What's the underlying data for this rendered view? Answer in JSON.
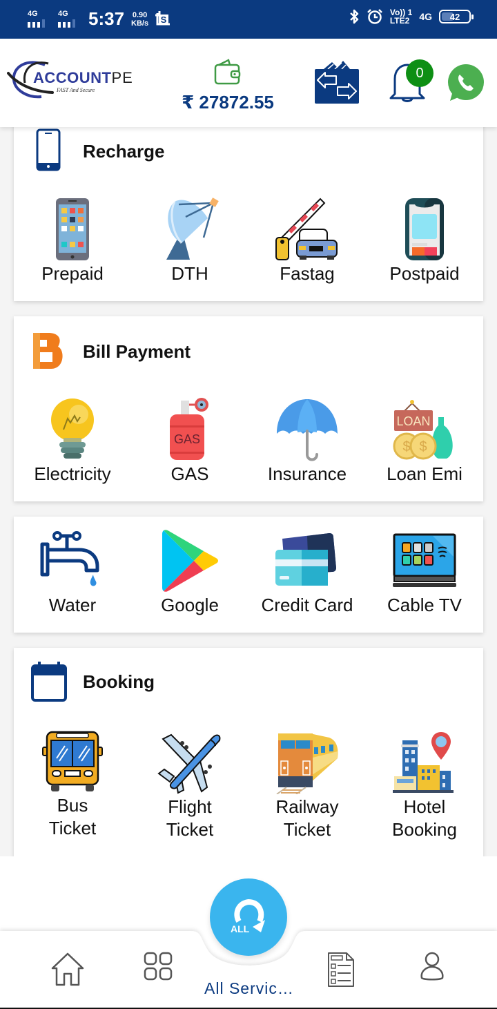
{
  "status_bar": {
    "sim1_network": "4G",
    "sim2_network": "4G",
    "time": "5:37",
    "speed_value": "0.90",
    "speed_unit": "KB/s",
    "volte_line1": "Vo)) 1",
    "volte_line2": "LTE2",
    "network_right": "4G",
    "battery": "42"
  },
  "header": {
    "logo_text_a": "ACCOUNT",
    "logo_text_b": "PE",
    "logo_tagline": "FAST And Secure",
    "wallet_balance": "₹ 27872.55",
    "notification_count": "0",
    "colors": {
      "primary": "#0b3a80",
      "accent_green": "#0e8f14",
      "whatsapp": "#4caf50",
      "fab": "#3ab5ee",
      "bill_orange": "#f07c1c"
    }
  },
  "sections": {
    "recharge": {
      "title": "Recharge",
      "items": [
        {
          "label": "Prepaid",
          "icon": "smartphone-icon"
        },
        {
          "label": "DTH",
          "icon": "satellite-dish-icon"
        },
        {
          "label": "Fastag",
          "icon": "toll-barrier-icon"
        },
        {
          "label": "Postpaid",
          "icon": "postpaid-phone-icon"
        }
      ]
    },
    "bill_payment": {
      "title": "Bill Payment",
      "items": [
        {
          "label": "Electricity",
          "icon": "light-bulb-icon"
        },
        {
          "label": "GAS",
          "icon": "gas-cylinder-icon",
          "icon_text": "GAS"
        },
        {
          "label": "Insurance",
          "icon": "umbrella-icon"
        },
        {
          "label": "Loan Emi",
          "icon": "loan-icon",
          "icon_text": "LOAN"
        }
      ]
    },
    "utilities": {
      "items": [
        {
          "label": "Water",
          "icon": "water-tap-icon"
        },
        {
          "label": "Google",
          "icon": "google-play-icon"
        },
        {
          "label": "Credit Card",
          "icon": "credit-card-icon"
        },
        {
          "label": "Cable TV",
          "icon": "cable-tv-icon"
        }
      ]
    },
    "booking": {
      "title": "Booking",
      "items": [
        {
          "label_line1": "Bus",
          "label_line2": "Ticket",
          "icon": "bus-icon"
        },
        {
          "label_line1": "Flight",
          "label_line2": "Ticket",
          "icon": "airplane-icon"
        },
        {
          "label_line1": "Railway",
          "label_line2": "Ticket",
          "icon": "train-icon"
        },
        {
          "label_line1": "Hotel",
          "label_line2": "Booking",
          "icon": "hotel-icon"
        }
      ]
    }
  },
  "bottom_nav": {
    "items": [
      {
        "name": "home",
        "icon": "home-icon"
      },
      {
        "name": "apps",
        "icon": "grid-icon"
      },
      {
        "name": "all-services",
        "icon": "all-services-icon",
        "label": "All Servic…",
        "fab_text": "ALL",
        "active": true
      },
      {
        "name": "reports",
        "icon": "report-icon"
      },
      {
        "name": "profile",
        "icon": "user-icon"
      }
    ]
  }
}
